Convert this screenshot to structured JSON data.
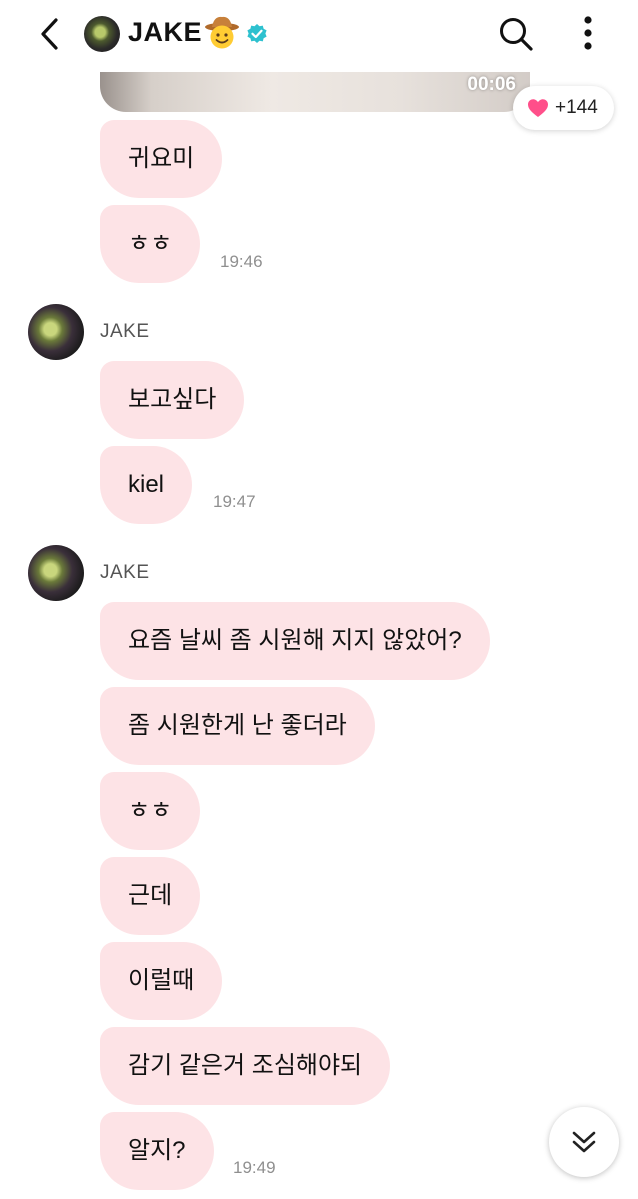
{
  "header": {
    "name": "JAKE",
    "emoji": "cowboy-face-emoji",
    "verified": true
  },
  "video": {
    "duration": "00:06"
  },
  "reaction": {
    "count": "+144",
    "icon": "heart-icon",
    "color": "#ff4f8a"
  },
  "bubble_color": "#fde3e6",
  "messages": [
    {
      "text": "귀요미"
    },
    {
      "text": "ㅎㅎ",
      "time": "19:46"
    },
    {
      "sender": "JAKE",
      "text": "보고싶다"
    },
    {
      "text": "kiel",
      "time": "19:47"
    },
    {
      "sender": "JAKE",
      "text": "요즘 날씨 좀 시원해 지지 않았어?"
    },
    {
      "text": "좀 시원한게 난 좋더라"
    },
    {
      "text": "ㅎㅎ"
    },
    {
      "text": "근데"
    },
    {
      "text": "이럴때"
    },
    {
      "text": "감기 같은거 조심해야되"
    },
    {
      "text": "알지?",
      "time": "19:49"
    }
  ]
}
